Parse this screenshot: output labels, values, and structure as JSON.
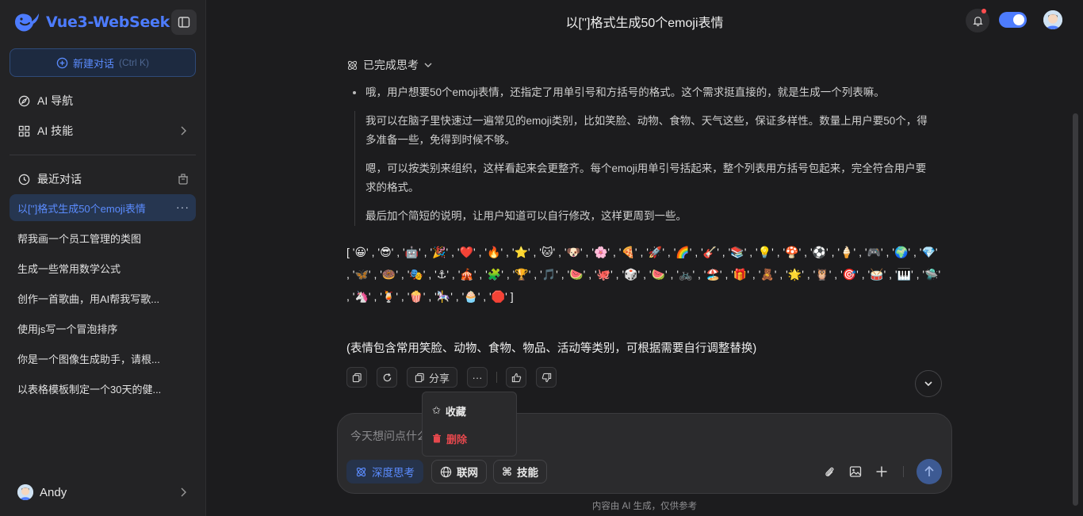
{
  "sidebar": {
    "brand": "Vue3-WebSeek",
    "new_chat": {
      "label": "新建对话",
      "shortcut": "(Ctrl K)"
    },
    "nav": [
      {
        "label": "AI 导航",
        "icon": "compass-icon"
      },
      {
        "label": "AI 技能",
        "icon": "grid-icon"
      }
    ],
    "recent_label": "最近对话",
    "chats": [
      "以['']格式生成50个emoji表情",
      "帮我画一个员工管理的类图",
      "生成一些常用数学公式",
      "创作一首歌曲，用AI帮我写歌...",
      "使用js写一个冒泡排序",
      "你是一个图像生成助手，请根...",
      "以表格模板制定一个30天的健..."
    ],
    "active_more": "···",
    "user_name": "Andy"
  },
  "header": {
    "title": "以['']格式生成50个emoji表情"
  },
  "thinking": {
    "label": "已完成思考",
    "paragraphs": [
      "哦，用户想要50个emoji表情，还指定了用单引号和方括号的格式。这个需求挺直接的，就是生成一个列表嘛。",
      "我可以在脑子里快速过一遍常见的emoji类别，比如笑脸、动物、食物、天气这些，保证多样性。数量上用户要50个，得多准备一些，免得到时候不够。",
      "嗯，可以按类别来组织，这样看起来会更整齐。每个emoji用单引号括起来，整个列表用方括号包起来，完全符合用户要求的格式。",
      "最后加个简短的说明，让用户知道可以自行修改，这样更周到一些。"
    ]
  },
  "answer": {
    "emojis": [
      "😀",
      "😎",
      "🤖",
      "🎉",
      "❤️",
      "🔥",
      "⭐",
      "🐱",
      "🐶",
      "🌸",
      "🍕",
      "🚀",
      "🌈",
      "🎸",
      "📚",
      "💡",
      "🍄",
      "⚽",
      "🍦",
      "🎮",
      "🌍",
      "💎",
      "🦋",
      "🍩",
      "🎭",
      "⚓",
      "🎪",
      "🧩",
      "🏆",
      "🎵",
      "🍉",
      "🐙",
      "🎲",
      "🍉",
      "🚲",
      "🏖️",
      "🎁",
      "🧸",
      "🌟",
      "🦉",
      "🎯",
      "🥁",
      "🎹",
      "🛸",
      "🦄",
      "🍹",
      "🍿",
      "🎠",
      "🧁",
      "🛑"
    ],
    "open_bracket": "[",
    "close_bracket": "]",
    "note": "(表情包含常用笑脸、动物、食物、物品、活动等类别，可根据需要自行调整替换)"
  },
  "actions": {
    "share_label": "分享",
    "more_label": "···",
    "menu": {
      "favorite": "收藏",
      "delete": "删除"
    }
  },
  "composer": {
    "placeholder": "今天想问点什么？",
    "deep_think": "深度思考",
    "web": "联网",
    "skills": "技能"
  },
  "footer": "内容由 AI 生成，仅供参考",
  "colors": {
    "accent": "#4d7cfe",
    "danger": "#e5484d",
    "bg": "#1c1c1e",
    "sidebar": "#232325"
  }
}
